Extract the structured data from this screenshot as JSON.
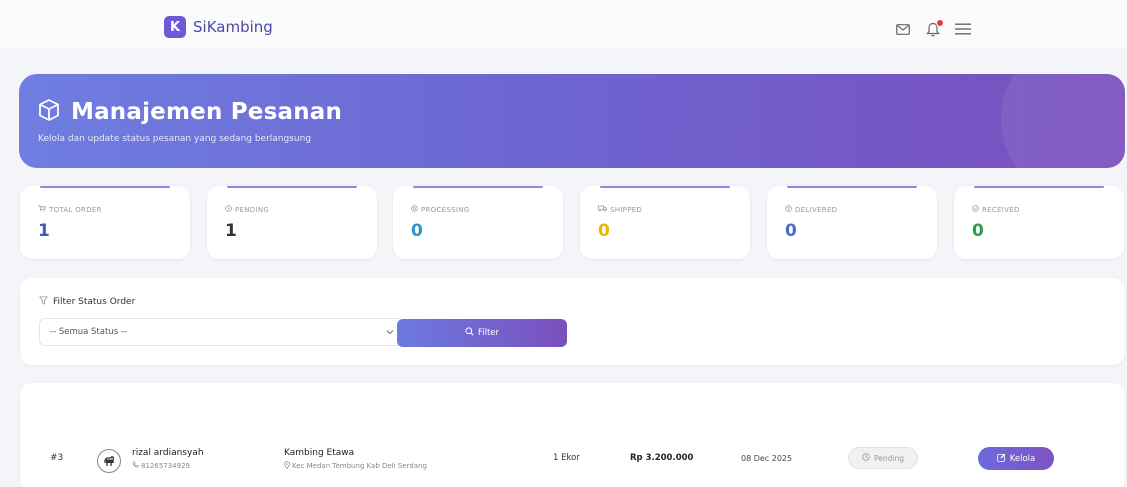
{
  "header": {
    "brand_letter": "K",
    "brand_name": "SiKambing",
    "icons": [
      "mail-icon",
      "bell-icon",
      "menu-icon"
    ]
  },
  "hero": {
    "title": "Manajemen Pesanan",
    "subtitle": "Kelola dan update status pesanan yang sedang berlangsung",
    "icon": "box-icon"
  },
  "stats": [
    {
      "label": "TOTAL ORDER",
      "value": "1",
      "color": "#3e5bc2",
      "icon": "cart-icon"
    },
    {
      "label": "PENDING",
      "value": "1",
      "color": "#333333",
      "icon": "clock-icon"
    },
    {
      "label": "PROCESSING",
      "value": "0",
      "color": "#2b95c4",
      "icon": "gear-icon"
    },
    {
      "label": "SHIPPED",
      "value": "0",
      "color": "#f0b400",
      "icon": "truck-icon"
    },
    {
      "label": "DELIVERED",
      "value": "0",
      "color": "#4a6ad0",
      "icon": "package-icon"
    },
    {
      "label": "RECEIVED",
      "value": "0",
      "color": "#2e9b4a",
      "icon": "check-circle-icon"
    }
  ],
  "filter": {
    "title": "Filter Status Order",
    "select_value": "-- Semua Status --",
    "button_label": "Filter"
  },
  "orders": [
    {
      "id": "#3",
      "customer_name": "rizal ardiansyah",
      "phone": "81265734929",
      "product": "Kambing Etawa",
      "location": "Kec Medan Tembung Kab Deli Serdang",
      "quantity": "1 Ekor",
      "price": "Rp 3.200.000",
      "date": "08 Dec 2025",
      "status": "Pending",
      "action_label": "Kelola"
    }
  ]
}
